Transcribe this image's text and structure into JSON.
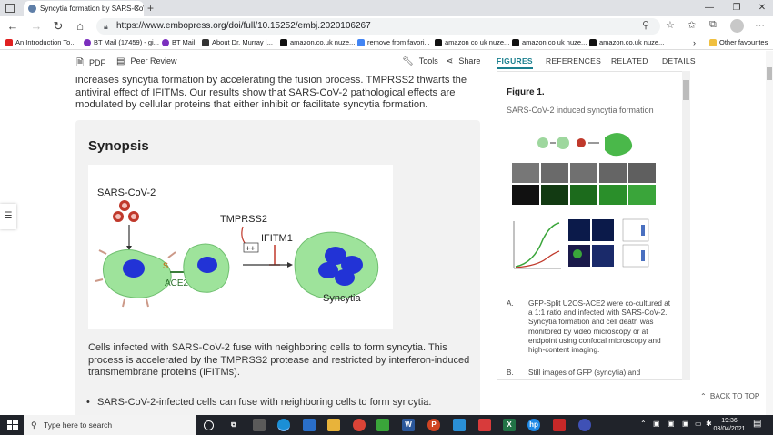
{
  "browser": {
    "tab_title": "Syncytia formation by SARS-Co\\",
    "url": "https://www.embopress.org/doi/full/10.15252/embj.2020106267",
    "bookmarks": [
      "An Introduction To...",
      "BT Mail (17459) - gi...",
      "BT Mail",
      "About Dr. Murray |...",
      "amazon.co.uk nuze...",
      "remove from favori...",
      "amazon co uk nuze...",
      "amazon co uk nuze...",
      "amazon.co.uk nuze..."
    ],
    "other_favourites": "Other favourites"
  },
  "article": {
    "pdf_label": "PDF",
    "peer_review_label": "Peer Review",
    "tools_label": "Tools",
    "share_label": "Share",
    "intro_text": "increases syncytia formation by accelerating the fusion process. TMPRSS2 thwarts the antiviral effect of IFITMs. Our results show that SARS-CoV-2 pathological effects are modulated by cellular proteins that either inhibit or facilitate syncytia formation.",
    "synopsis_title": "Synopsis",
    "synopsis_figure": {
      "virus_label": "SARS-CoV-2",
      "protease_label": "TMPRSS2",
      "ifitm_label": "IFITM1",
      "spike_label": "S",
      "receptor_label": "ACE2",
      "plus_label": "++",
      "result_label": "Syncytia"
    },
    "synopsis_text": "Cells infected with SARS-CoV-2 fuse with neighboring cells to form syncytia. This process is accelerated by the TMPRSS2 protease and restricted by interferon-induced transmembrane proteins (IFITMs).",
    "bullet_1": "SARS-CoV-2-infected cells can fuse with neighboring cells to form syncytia."
  },
  "side_panel": {
    "tabs": [
      "FIGURES",
      "REFERENCES",
      "RELATED",
      "DETAILS"
    ],
    "active_tab": "FIGURES",
    "figure_label": "Figure 1.",
    "figure_caption": "SARS-CoV-2 induced syncytia formation",
    "items": [
      {
        "letter": "A.",
        "text": "GFP-Split U2OS-ACE2 were co-cultured at a 1:1 ratio and infected with SARS-CoV-2. Syncytia formation and cell death was monitored by video microscopy or at endpoint using confocal microscopy and high-content imaging."
      },
      {
        "letter": "B.",
        "text": "Still images of GFP (syncytia) and"
      }
    ],
    "back_to_top": "BACK TO TOP"
  },
  "taskbar": {
    "search_placeholder": "Type here to search",
    "time": "19:36",
    "date": "03/04/2021"
  },
  "colors": {
    "accent_teal": "#1a7f8e",
    "cell_green": "#8fd694",
    "nucleus_blue": "#2233d6",
    "virus_red": "#c0392b"
  }
}
